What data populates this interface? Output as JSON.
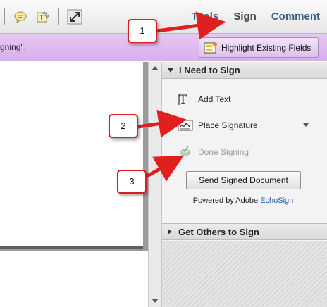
{
  "toolbar": {
    "icons": [
      "comment-icon",
      "stamp-icon",
      "expand-icon"
    ],
    "tabs": [
      {
        "label": "Tools"
      },
      {
        "label": "Sign"
      },
      {
        "label": "Comment"
      }
    ]
  },
  "purple_bar": {
    "text": "gning\".",
    "highlight_button": "Highlight Existing Fields"
  },
  "sign_panel": {
    "section_title": "I Need to Sign",
    "items": [
      {
        "label": "Add Text",
        "icon": "text-tool-icon"
      },
      {
        "label": "Place Signature",
        "icon": "signature-icon"
      },
      {
        "label": "Done Signing",
        "icon": "done-signing-icon"
      }
    ],
    "send_button": "Send Signed Document",
    "powered_prefix": "Powered by Adobe",
    "powered_brand": "EchoSign",
    "others_title": "Get Others to Sign"
  },
  "callouts": [
    "1",
    "2",
    "3"
  ],
  "colors": {
    "accent_tab": "#3a5e83",
    "purple_bar": "#d9b4ee",
    "callout_border": "#d81e1e",
    "arrow": "#e01f1f",
    "brand_link": "#1d5fa9"
  }
}
